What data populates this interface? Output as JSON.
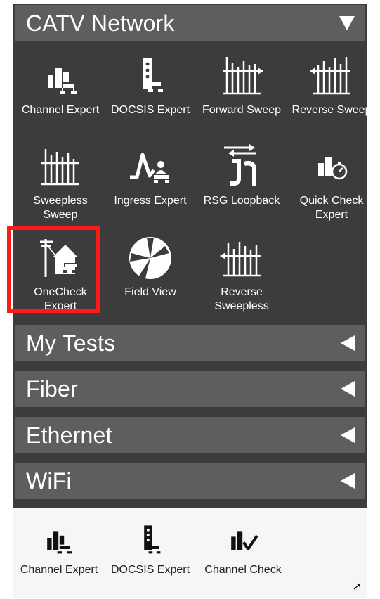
{
  "sections": {
    "catv": {
      "title": "CATV Network",
      "state": "expanded"
    },
    "my_tests": {
      "title": "My Tests",
      "state": "collapsed"
    },
    "fiber": {
      "title": "Fiber",
      "state": "collapsed"
    },
    "ethernet": {
      "title": "Ethernet",
      "state": "collapsed"
    },
    "wifi": {
      "title": "WiFi",
      "state": "collapsed"
    }
  },
  "catv_apps": [
    {
      "label": "Channel Expert",
      "icon": "channel-expert-icon"
    },
    {
      "label": "DOCSIS Expert",
      "icon": "docsis-expert-icon"
    },
    {
      "label": "Forward Sweep",
      "icon": "forward-sweep-icon"
    },
    {
      "label": "Reverse Sweep",
      "icon": "reverse-sweep-icon"
    },
    {
      "label": "Sweepless\nSweep",
      "icon": "sweepless-sweep-icon"
    },
    {
      "label": "Ingress Expert",
      "icon": "ingress-expert-icon"
    },
    {
      "label": "RSG Loopback",
      "icon": "rsg-loopback-icon"
    },
    {
      "label": "Quick Check\nExpert",
      "icon": "quick-check-icon"
    },
    {
      "label": "OneCheck\nExpert",
      "icon": "onecheck-expert-icon",
      "highlighted": true
    },
    {
      "label": "Field View",
      "icon": "field-view-icon"
    },
    {
      "label": "Reverse\nSweepless",
      "icon": "reverse-sweepless-icon"
    }
  ],
  "dock": [
    {
      "label": "Channel Expert",
      "icon": "channel-expert-icon"
    },
    {
      "label": "DOCSIS Expert",
      "icon": "docsis-expert-icon"
    },
    {
      "label": "Channel Check",
      "icon": "channel-check-icon"
    }
  ],
  "colors": {
    "background": "#3c3c3c",
    "header": "#5e5e5e",
    "highlight": "#ff1a1a",
    "dock": "#f6f6f6"
  }
}
